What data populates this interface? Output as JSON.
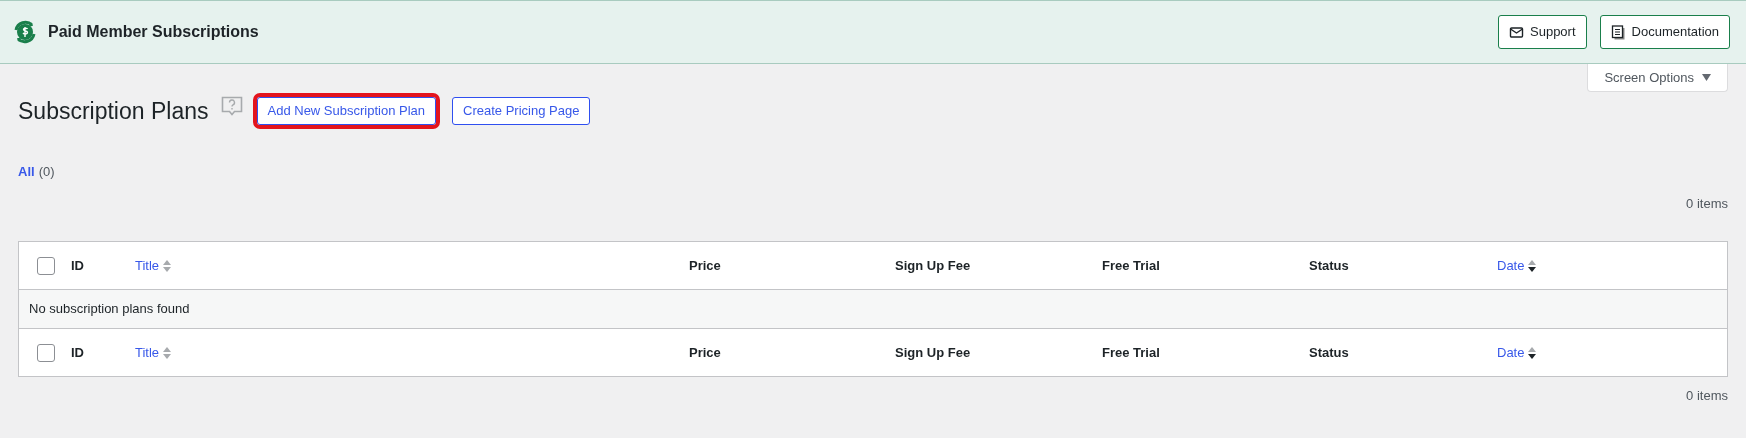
{
  "header": {
    "title": "Paid Member Subscriptions",
    "buttons": [
      {
        "label": "Support"
      },
      {
        "label": "Documentation"
      }
    ]
  },
  "screen_options": {
    "label": "Screen Options"
  },
  "page": {
    "title": "Subscription Plans",
    "actions": [
      {
        "label": "Add New Subscription Plan",
        "highlighted": true
      },
      {
        "label": "Create Pricing Page",
        "highlighted": false
      }
    ]
  },
  "filters": [
    {
      "label": "All",
      "count": "(0)",
      "selected": true
    }
  ],
  "item_count_top": "0 items",
  "table": {
    "select_all_checked": false,
    "columns": [
      {
        "label": "ID",
        "sortable": false
      },
      {
        "label": "Title",
        "sortable": true,
        "sorted": false
      },
      {
        "label": "Price",
        "sortable": false
      },
      {
        "label": "Sign Up Fee",
        "sortable": false
      },
      {
        "label": "Free Trial",
        "sortable": false
      },
      {
        "label": "Status",
        "sortable": false
      },
      {
        "label": "Date",
        "sortable": true,
        "sorted": true
      }
    ],
    "empty_message": "No subscription plans found",
    "footer_select_all_checked": false,
    "footer_columns": [
      {
        "label": "ID",
        "sortable": false
      },
      {
        "label": "Title",
        "sortable": true,
        "sorted": false
      },
      {
        "label": "Price",
        "sortable": false
      },
      {
        "label": "Sign Up Fee",
        "sortable": false
      },
      {
        "label": "Free Trial",
        "sortable": false
      },
      {
        "label": "Status",
        "sortable": false
      },
      {
        "label": "Date",
        "sortable": true,
        "sorted": true
      }
    ]
  },
  "item_count_bottom": "0 items"
}
